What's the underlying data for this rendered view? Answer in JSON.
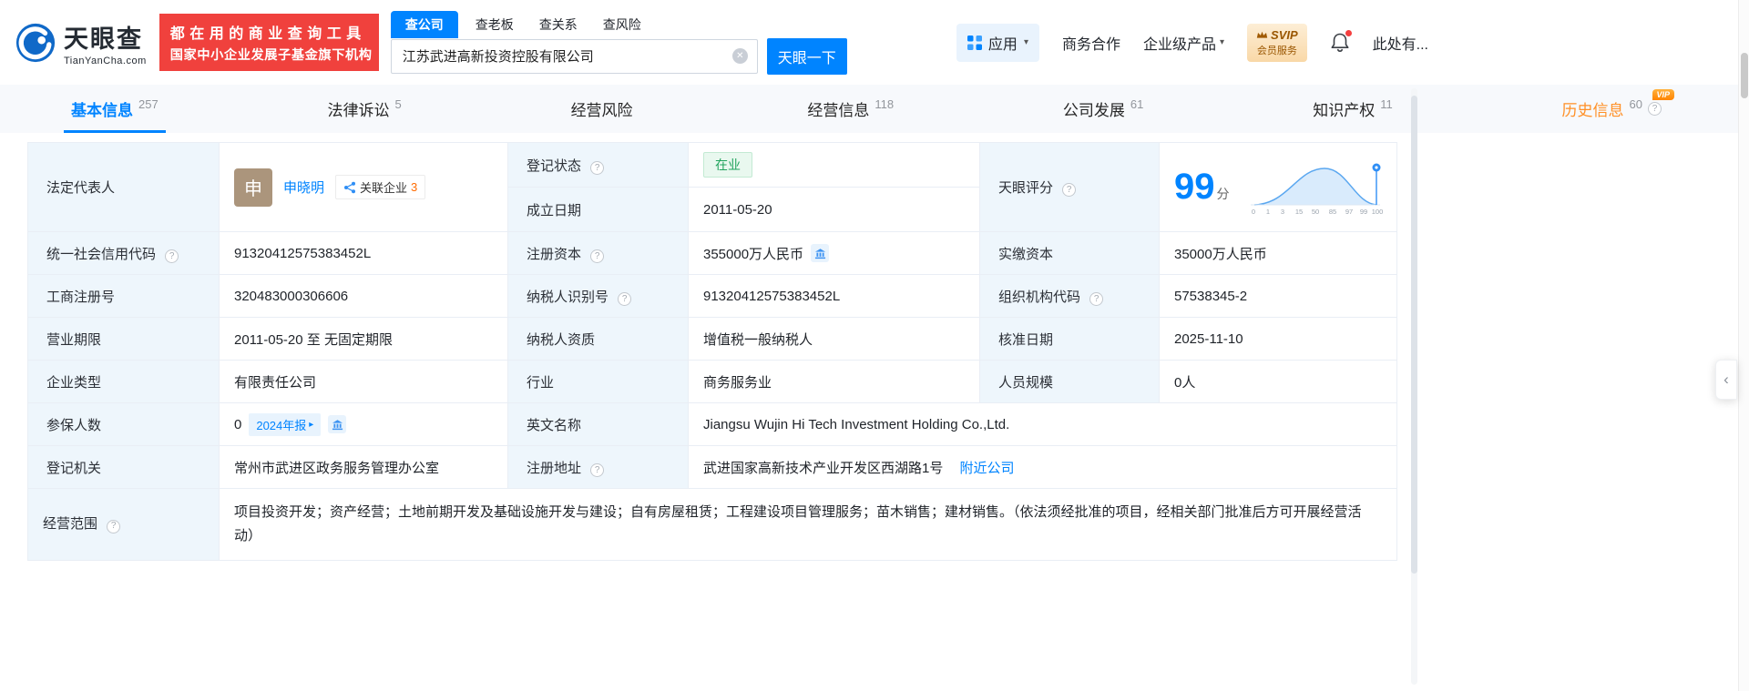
{
  "icons": {
    "help": "?",
    "clear": "✕",
    "caret_down": "▾",
    "arrow_right": "▸",
    "chevron_left": "‹"
  },
  "header": {
    "brand_cn": "天眼查",
    "brand_en": "TianYanCha.com",
    "slogan_line1": "都在用的商业查询工具",
    "slogan_line2": "国家中小企业发展子基金旗下机构",
    "search_tabs": [
      "查公司",
      "查老板",
      "查关系",
      "查风险"
    ],
    "search_value": "江苏武进高新投资控股有限公司",
    "search_button": "天眼一下",
    "nav_apps": "应用",
    "nav_cooperation": "商务合作",
    "nav_enterprise": "企业级产品",
    "svip_top": "SVIP",
    "svip_bottom": "会员服务",
    "nav_more": "此处有..."
  },
  "tabs": [
    {
      "label": "基本信息",
      "count": "257"
    },
    {
      "label": "法律诉讼",
      "count": "5"
    },
    {
      "label": "经营风险",
      "count": ""
    },
    {
      "label": "经营信息",
      "count": "118"
    },
    {
      "label": "公司发展",
      "count": "61"
    },
    {
      "label": "知识产权",
      "count": "11"
    },
    {
      "label": "历史信息",
      "count": "60",
      "vip": "VIP"
    }
  ],
  "info": {
    "legal_rep": {
      "label": "法定代表人",
      "avatar": "申",
      "name": "申晓明",
      "related_label": "关联企业",
      "related_count": "3"
    },
    "reg_status": {
      "label": "登记状态",
      "value": "在业"
    },
    "establish_date": {
      "label": "成立日期",
      "value": "2011-05-20"
    },
    "score": {
      "label": "天眼评分",
      "value": "99",
      "unit": "分",
      "axis": [
        "0",
        "1",
        "3",
        "15",
        "50",
        "85",
        "97",
        "99",
        "100"
      ]
    },
    "credit_code": {
      "label": "统一社会信用代码",
      "value": "91320412575383452L"
    },
    "reg_capital": {
      "label": "注册资本",
      "value": "355000万人民币"
    },
    "paid_capital": {
      "label": "实缴资本",
      "value": "35000万人民币"
    },
    "reg_number": {
      "label": "工商注册号",
      "value": "320483000306606"
    },
    "taxpayer_id": {
      "label": "纳税人识别号",
      "value": "91320412575383452L"
    },
    "org_code": {
      "label": "组织机构代码",
      "value": "57538345-2"
    },
    "business_term": {
      "label": "营业期限",
      "value": "2011-05-20 至 无固定期限"
    },
    "taxpayer_quality": {
      "label": "纳税人资质",
      "value": "增值税一般纳税人"
    },
    "approval_date": {
      "label": "核准日期",
      "value": "2025-11-10"
    },
    "company_type": {
      "label": "企业类型",
      "value": "有限责任公司"
    },
    "industry": {
      "label": "行业",
      "value": "商务服务业"
    },
    "staff_size": {
      "label": "人员规模",
      "value": "0人"
    },
    "insured": {
      "label": "参保人数",
      "value": "0",
      "report_link": "2024年报"
    },
    "english_name": {
      "label": "英文名称",
      "value": "Jiangsu Wujin Hi Tech Investment Holding Co.,Ltd."
    },
    "reg_authority": {
      "label": "登记机关",
      "value": "常州市武进区政务服务管理办公室"
    },
    "reg_address": {
      "label": "注册地址",
      "value": "武进国家高新技术产业开发区西湖路1号",
      "nearby_link": "附近公司"
    },
    "business_scope": {
      "label": "经营范围",
      "value": "项目投资开发；资产经营；土地前期开发及基础设施开发与建设；自有房屋租赁；工程建设项目管理服务；苗木销售；建材销售。（依法须经批准的项目，经相关部门批准后方可开展经营活动）"
    }
  }
}
